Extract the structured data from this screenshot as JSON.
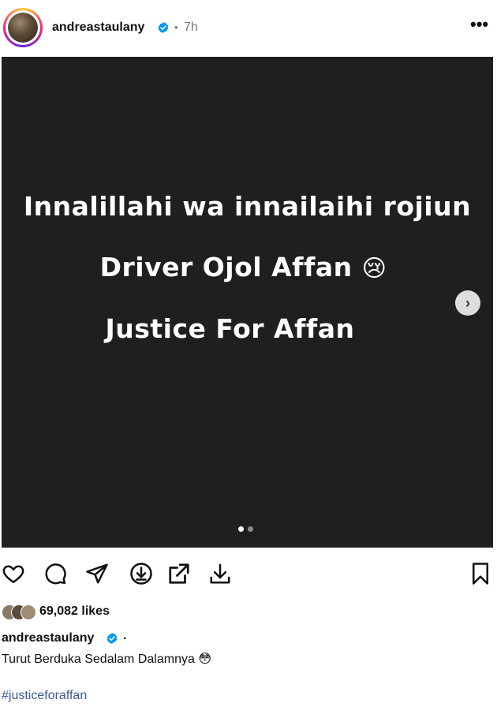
{
  "post": {
    "username": "andreastaulany",
    "separator": "•",
    "time": "7h",
    "more_label": "•••",
    "media": {
      "line1": "Innalillahi wa innailaihi rojiun",
      "line2": "Driver Ojol Affan",
      "line2_emoji": "😢",
      "line3": "Justice For Affan",
      "next_label": "›",
      "carousel": {
        "count": 2,
        "active_index": 0
      }
    },
    "likes": "69,082 likes",
    "caption": {
      "username": "andreastaulany",
      "after_user": ".",
      "text": "Turut Berduka Sedalam Dalamnya",
      "text_emoji": "😳",
      "hashtag": "#justiceforaffan"
    }
  },
  "icons": {
    "actions": [
      "heart-icon",
      "comment-icon",
      "share-icon",
      "download-circle-icon",
      "open-external-icon",
      "download-icon",
      "bookmark-icon"
    ],
    "verified_color": "#0095f6"
  }
}
